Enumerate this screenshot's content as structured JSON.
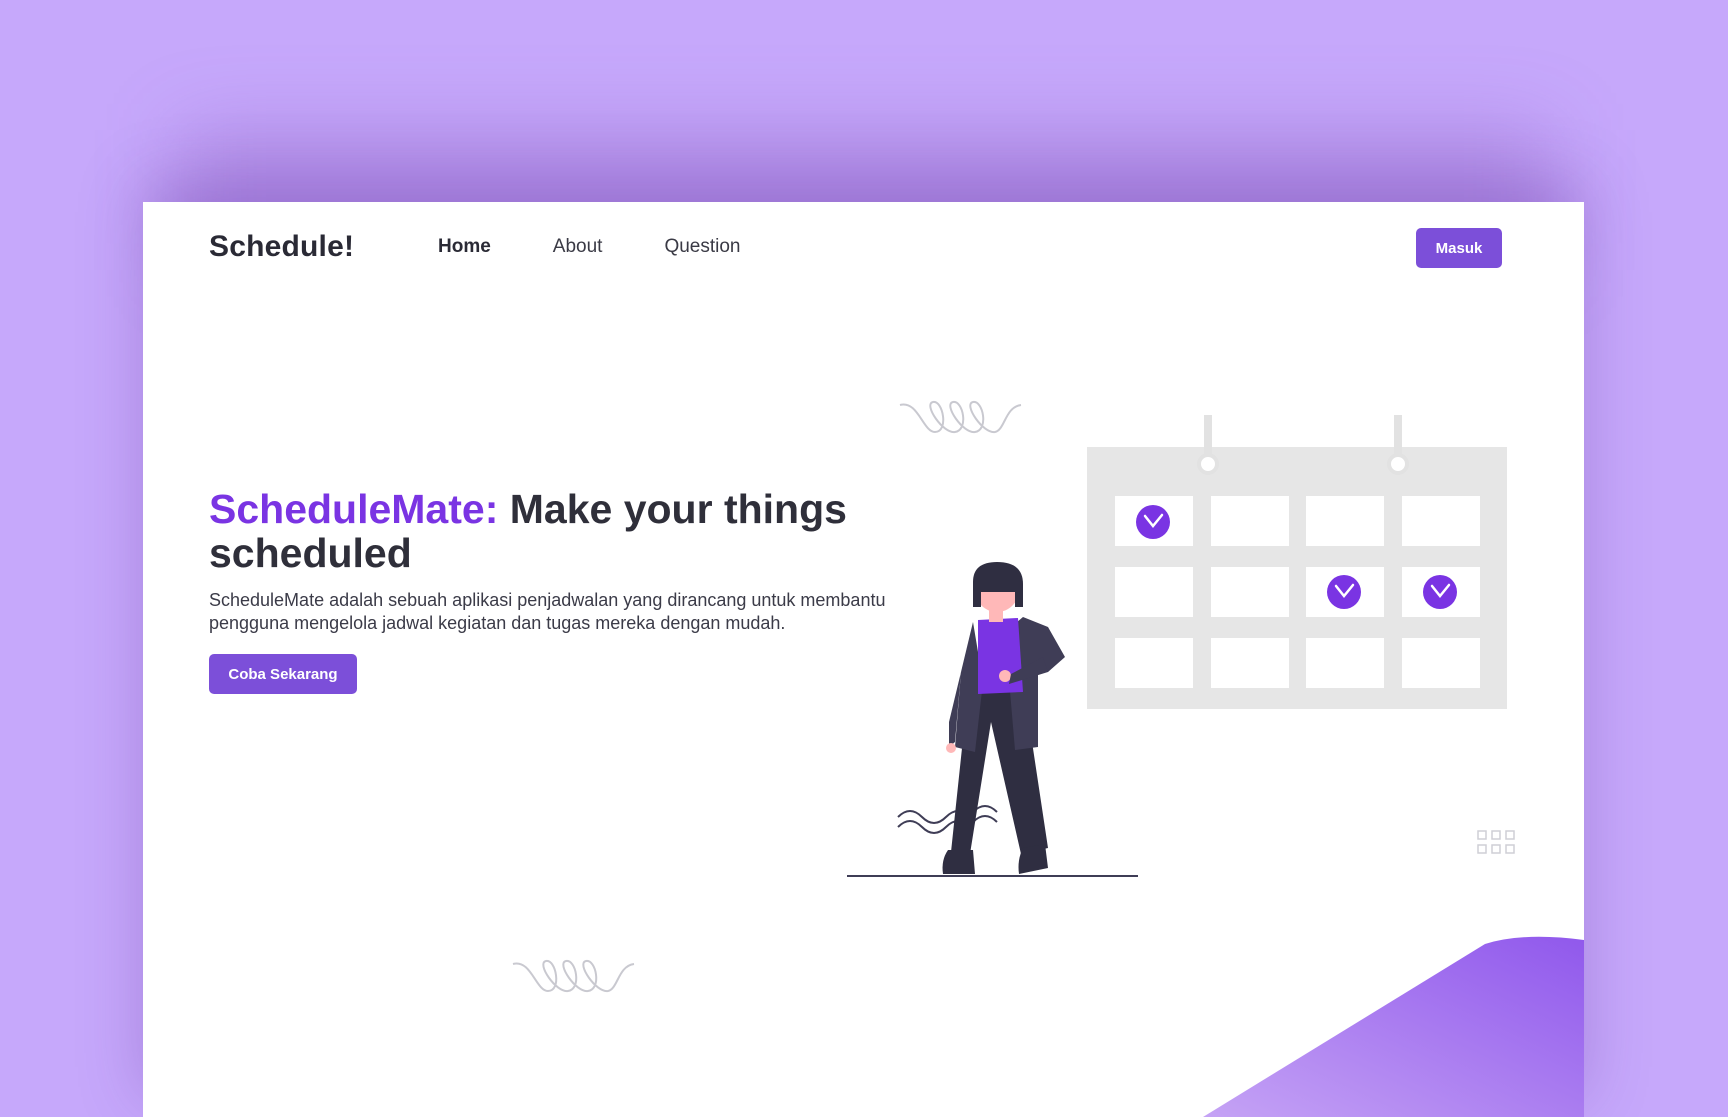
{
  "header": {
    "logo": "Schedule!",
    "nav": [
      {
        "label": "Home",
        "active": true
      },
      {
        "label": "About",
        "active": false
      },
      {
        "label": "Question",
        "active": false
      }
    ],
    "login_label": "Masuk"
  },
  "hero": {
    "title_brand": "ScheduleMate:",
    "title_rest": "Make your things scheduled",
    "description": "ScheduleMate adalah sebuah aplikasi penjadwalan yang dirancang untuk membantu pengguna mengelola jadwal kegiatan dan tugas mereka dengan mudah.",
    "cta_label": "Coba Sekarang"
  },
  "colors": {
    "background": "#c6a8fb",
    "accent": "#7c4fd9",
    "brand_text": "#7a34e3",
    "calendar": "#e6e6e6",
    "text_dark": "#2f2f3a"
  },
  "icons": {
    "checked_days": "check-circle-icon",
    "decor_grid": "grid-dots-icon",
    "decor_squiggle": "squiggle-icon"
  }
}
